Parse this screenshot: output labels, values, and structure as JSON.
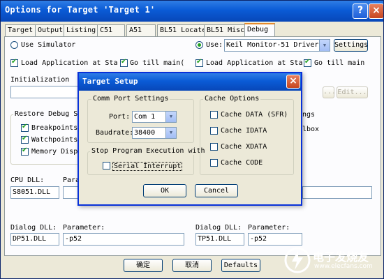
{
  "window": {
    "title": "Options for Target 'Target 1'",
    "help_glyph": "?",
    "close_glyph": "×"
  },
  "tabs": [
    {
      "label": "Target",
      "active": false
    },
    {
      "label": "Output",
      "active": false
    },
    {
      "label": "Listing",
      "active": false
    },
    {
      "label": "C51",
      "active": false
    },
    {
      "label": "A51",
      "active": false
    },
    {
      "label": "BL51 Locate",
      "active": false
    },
    {
      "label": "BL51 Misc",
      "active": false
    },
    {
      "label": "Debug",
      "active": true
    }
  ],
  "left": {
    "use_simulator": "Use Simulator",
    "load_app": "Load Application at Sta",
    "go_till_main": "Go  till main(",
    "initialization": "Initialization",
    "restore_title": "Restore Debug Ses",
    "restore_items": [
      "Breakpoints",
      "Watchpoints &",
      "Memory Displ"
    ],
    "cpu_dll_label": "CPU DLL:",
    "cpu_dll_value": "S8051.DLL",
    "param_label_cut": "Para",
    "dialog_dll_label": "Dialog DLL:",
    "dialog_dll_value": "DP51.DLL",
    "parameter_label": "Parameter:",
    "parameter_value": "-p52"
  },
  "right": {
    "use_label": "Use:",
    "driver_value": "Keil Monitor-51 Driver",
    "settings_button": "Settings",
    "load_app": "Load Application at Sta",
    "go_till_main": "Go  till main",
    "browse_button": "...",
    "edit_button": "Edit...",
    "behind_text_1": "ngs",
    "behind_text_2": "lbox",
    "dialog_dll_label": "Dialog DLL:",
    "dialog_dll_value": "TP51.DLL",
    "parameter_label": "Parameter:",
    "parameter_value": "-p52"
  },
  "bottom": {
    "ok": "确定",
    "cancel": "取消",
    "defaults": "Defaults"
  },
  "dialog": {
    "title": "Target Setup",
    "close_glyph": "×",
    "comm_title": "Comm Port Settings",
    "port_label": "Port:",
    "port_value": "Com 1",
    "baud_label": "Baudrate:",
    "baud_value": "38400",
    "stop_title": "Stop Program Execution with",
    "serial_interrupt": "Serial Interrupt",
    "cache_title": "Cache Options",
    "cache_items": [
      "Cache DATA (SFR)",
      "Cache IDATA",
      "Cache XDATA",
      "Cache CODE"
    ],
    "ok": "OK",
    "cancel": "Cancel"
  },
  "watermark": {
    "brand": "电子发烧友",
    "url": "www.elecfans.com"
  }
}
